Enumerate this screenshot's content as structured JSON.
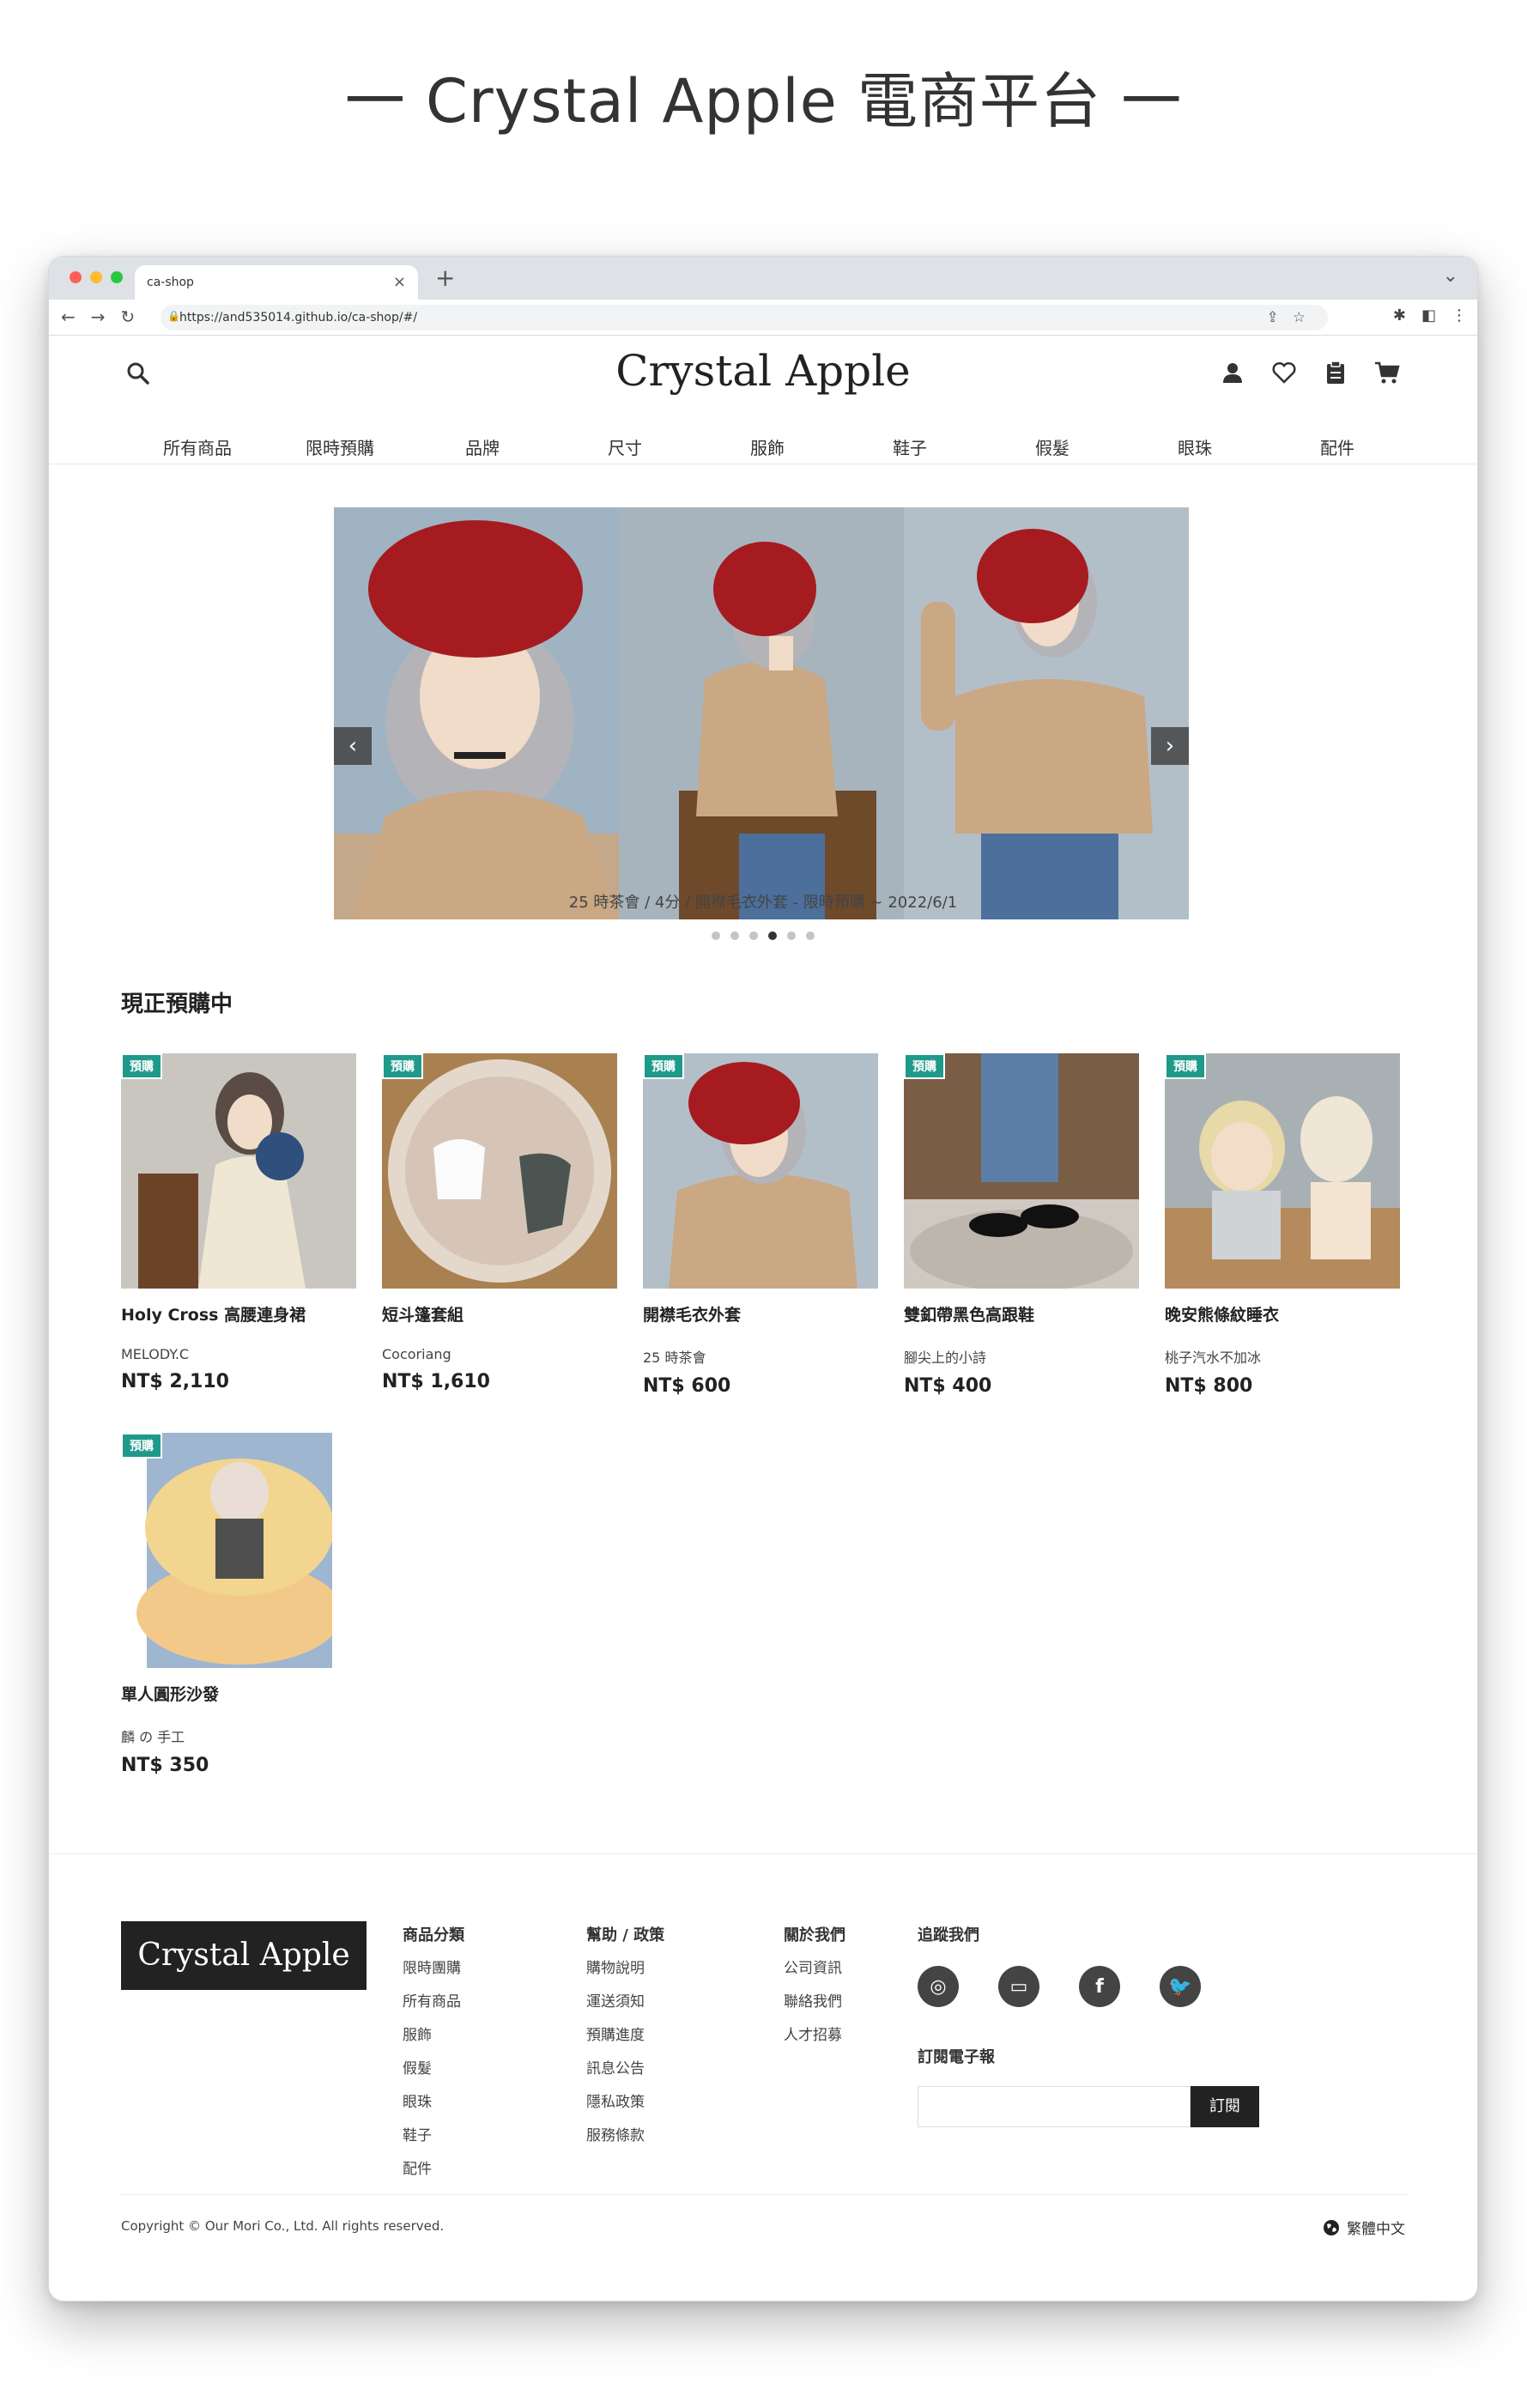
{
  "heading": "一 Crystal Apple 電商平台 一",
  "browser": {
    "tab_title": "ca-shop",
    "url": "https://and535014.github.io/ca-shop/#/"
  },
  "site": {
    "logo": "Crystal Apple",
    "nav": [
      "所有商品",
      "限時預購",
      "品牌",
      "尺寸",
      "服飾",
      "鞋子",
      "假髮",
      "眼珠",
      "配件"
    ]
  },
  "carousel": {
    "caption": "25 時茶會 / 4分 / 開襟毛衣外套 - 限時預購 ~ 2022/6/1",
    "slide_count": 6,
    "active_index": 3
  },
  "section_title": "現正預購中",
  "products": [
    {
      "badge": "預購",
      "name": "Holy Cross 高腰連身裙",
      "brand": "MELODY.C",
      "price": "NT$ 2,110"
    },
    {
      "badge": "預購",
      "name": "短斗篷套組",
      "brand": "Cocoriang",
      "price": "NT$ 1,610"
    },
    {
      "badge": "預購",
      "name": "開襟毛衣外套",
      "brand": "25 時茶會",
      "price": "NT$ 600"
    },
    {
      "badge": "預購",
      "name": "雙釦帶黑色高跟鞋",
      "brand": "腳尖上的小詩",
      "price": "NT$ 400"
    },
    {
      "badge": "預購",
      "name": "晚安熊條紋睡衣",
      "brand": "桃子汽水不加冰",
      "price": "NT$ 800"
    },
    {
      "badge": "預購",
      "name": "單人圓形沙發",
      "brand": "麟 の 手工",
      "price": "NT$ 350"
    }
  ],
  "footer": {
    "logo": "Crystal Apple",
    "col1": {
      "title": "商品分類",
      "links": [
        "限時團購",
        "所有商品",
        "服飾",
        "假髮",
        "眼珠",
        "鞋子",
        "配件"
      ]
    },
    "col2": {
      "title": "幫助 / 政策",
      "links": [
        "購物說明",
        "運送須知",
        "預購進度",
        "訊息公告",
        "隱私政策",
        "服務條款"
      ]
    },
    "col3": {
      "title": "關於我們",
      "links": [
        "公司資訊",
        "聯絡我們",
        "人才招募"
      ]
    },
    "follow_title": "追蹤我們",
    "newsletter_title": "訂閱電子報",
    "subscribe_label": "訂閱",
    "copyright": "Copyright © Our Mori Co., Ltd. All rights reserved.",
    "language": "繁體中文"
  }
}
